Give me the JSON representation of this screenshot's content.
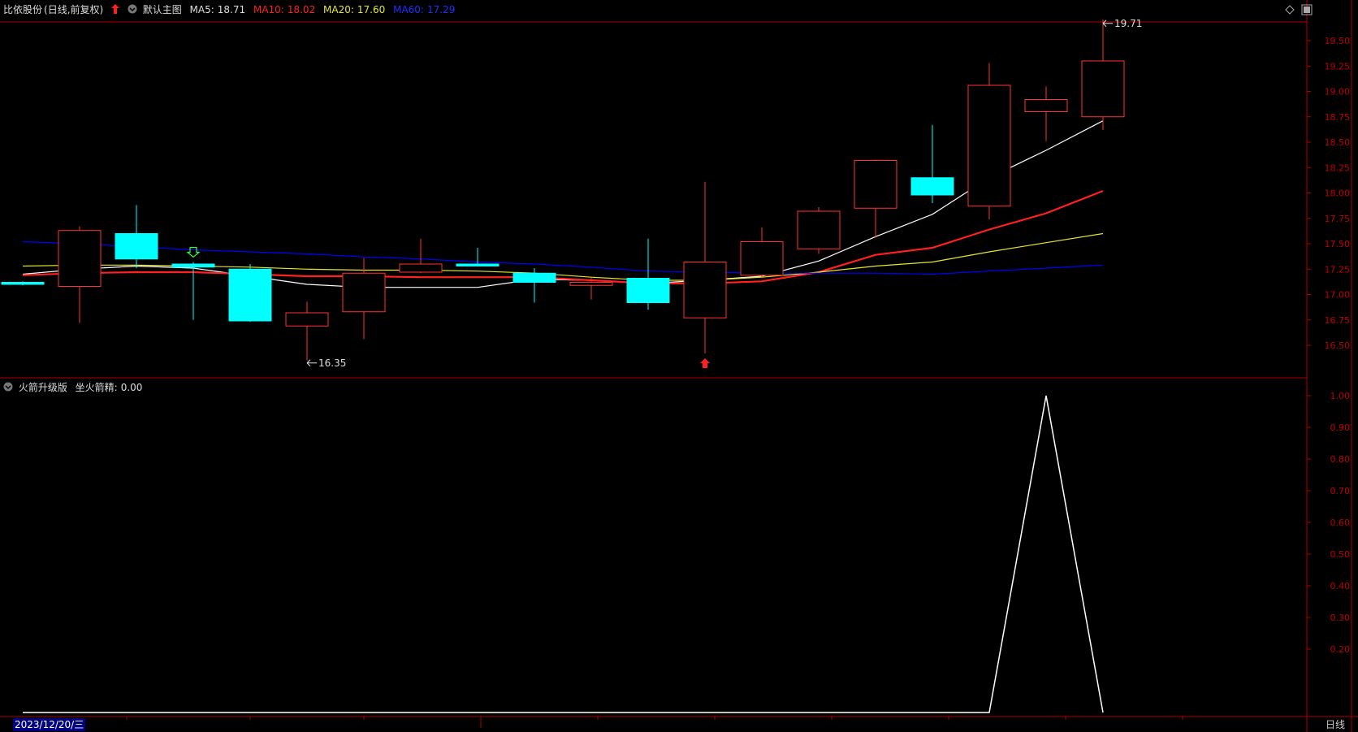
{
  "header": {
    "stock_name": "比依股份",
    "period_info": "(日线,前复权)",
    "template_name": "默认主图",
    "ma5_label": "MA5:",
    "ma5_value": "18.71",
    "ma10_label": "MA10:",
    "ma10_value": "18.02",
    "ma20_label": "MA20:",
    "ma20_value": "17.60",
    "ma60_label": "MA60:",
    "ma60_value": "17.29",
    "up_arrow_icon": "red-up-arrow-icon",
    "dropdown_icon": "circle-dropdown-icon"
  },
  "indicator_header": {
    "name": "火箭升级版",
    "series_label": "坐火箭精:",
    "series_value": "0.00",
    "dropdown_icon": "circle-dropdown-icon"
  },
  "footer": {
    "date": "2023/12/20/三",
    "period": "日线"
  },
  "colors": {
    "background": "#000000",
    "frame": "#b00000",
    "up_candle": "#ff3232",
    "down_candle": "#00ffff",
    "ma5": "#ffffff",
    "ma10": "#ff2020",
    "ma20": "#e6e632",
    "ma60": "#0000ff",
    "indicator_line": "#ffffff",
    "axis_text": "#c00000"
  },
  "chart_data": [
    {
      "type": "candlestick",
      "title": "比依股份 (日线,前复权)",
      "ylim": [
        16.2,
        19.8
      ],
      "yticks": [
        16.5,
        16.75,
        17.0,
        17.25,
        17.5,
        17.75,
        18.0,
        18.25,
        18.5,
        18.75,
        19.0,
        19.25,
        19.5
      ],
      "ytick_labels": [
        "16.50",
        "16.75",
        "17.00",
        "17.25",
        "17.50",
        "17.75",
        "18.00",
        "18.25",
        "18.50",
        "18.75",
        "19.00",
        "19.25",
        "19.50"
      ],
      "candles": [
        {
          "open": 17.12,
          "high": 17.13,
          "low": 17.09,
          "close": 17.1
        },
        {
          "open": 17.08,
          "high": 17.67,
          "low": 16.72,
          "close": 17.63
        },
        {
          "open": 17.6,
          "high": 17.88,
          "low": 17.26,
          "close": 17.35
        },
        {
          "open": 17.3,
          "high": 17.32,
          "low": 16.75,
          "close": 17.27
        },
        {
          "open": 17.25,
          "high": 17.3,
          "low": 16.73,
          "close": 16.74
        },
        {
          "open": 16.69,
          "high": 16.93,
          "low": 16.35,
          "close": 16.82
        },
        {
          "open": 16.83,
          "high": 17.36,
          "low": 16.56,
          "close": 17.21
        },
        {
          "open": 17.22,
          "high": 17.55,
          "low": 17.21,
          "close": 17.3
        },
        {
          "open": 17.3,
          "high": 17.46,
          "low": 17.28,
          "close": 17.28
        },
        {
          "open": 17.21,
          "high": 17.26,
          "low": 16.92,
          "close": 17.12
        },
        {
          "open": 17.09,
          "high": 17.17,
          "low": 16.95,
          "close": 17.12
        },
        {
          "open": 17.16,
          "high": 17.55,
          "low": 16.85,
          "close": 16.92
        },
        {
          "open": 16.77,
          "high": 18.11,
          "low": 16.42,
          "close": 17.32
        },
        {
          "open": 17.19,
          "high": 17.66,
          "low": 17.16,
          "close": 17.52
        },
        {
          "open": 17.45,
          "high": 17.86,
          "low": 17.4,
          "close": 17.82
        },
        {
          "open": 17.85,
          "high": 18.33,
          "low": 17.56,
          "close": 18.32
        },
        {
          "open": 18.15,
          "high": 18.67,
          "low": 17.9,
          "close": 17.98
        },
        {
          "open": 17.87,
          "high": 19.28,
          "low": 17.74,
          "close": 19.06
        },
        {
          "open": 18.8,
          "high": 19.05,
          "low": 18.51,
          "close": 18.92
        },
        {
          "open": 18.75,
          "high": 19.71,
          "low": 18.62,
          "close": 19.3
        }
      ],
      "series": [
        {
          "name": "MA5",
          "values": [
            17.2,
            17.25,
            17.28,
            17.26,
            17.18,
            17.1,
            17.07,
            17.07,
            17.07,
            17.15,
            17.14,
            17.11,
            17.14,
            17.18,
            17.33,
            17.57,
            17.79,
            18.15,
            18.42,
            18.71
          ]
        },
        {
          "name": "MA10",
          "values": [
            17.19,
            17.21,
            17.22,
            17.22,
            17.2,
            17.18,
            17.18,
            17.17,
            17.17,
            17.17,
            17.14,
            17.11,
            17.11,
            17.13,
            17.22,
            17.39,
            17.46,
            17.64,
            17.8,
            18.02
          ]
        },
        {
          "name": "MA20",
          "values": [
            17.28,
            17.29,
            17.29,
            17.28,
            17.27,
            17.25,
            17.24,
            17.24,
            17.23,
            17.21,
            17.17,
            17.14,
            17.14,
            17.17,
            17.22,
            17.28,
            17.32,
            17.42,
            17.51,
            17.6
          ]
        },
        {
          "name": "MA60",
          "values": [
            17.52,
            17.5,
            17.47,
            17.44,
            17.42,
            17.4,
            17.37,
            17.35,
            17.32,
            17.3,
            17.27,
            17.23,
            17.22,
            17.21,
            17.21,
            17.21,
            17.2,
            17.23,
            17.26,
            17.29
          ]
        }
      ],
      "annotations": [
        {
          "text": "16.35",
          "index": 5,
          "value": 16.35
        },
        {
          "text": "19.71",
          "index": 19,
          "value": 19.71
        }
      ],
      "signals": [
        {
          "kind": "green-down-arrow",
          "index": 3
        },
        {
          "kind": "red-up-arrow",
          "index": 12
        }
      ]
    },
    {
      "type": "line",
      "title": "火箭升级版",
      "ylim": [
        0.0,
        1.05
      ],
      "yticks": [
        0.2,
        0.3,
        0.4,
        0.5,
        0.6,
        0.7,
        0.8,
        0.9,
        1.0
      ],
      "ytick_labels": [
        "0.20",
        "0.30",
        "0.40",
        "0.50",
        "0.60",
        "0.70",
        "0.80",
        "0.90",
        "1.00"
      ],
      "series": [
        {
          "name": "坐火箭精",
          "values": [
            0,
            0,
            0,
            0,
            0,
            0,
            0,
            0,
            0,
            0,
            0,
            0,
            0,
            0,
            0,
            0,
            0,
            0,
            1.0,
            0.0
          ]
        }
      ]
    }
  ]
}
